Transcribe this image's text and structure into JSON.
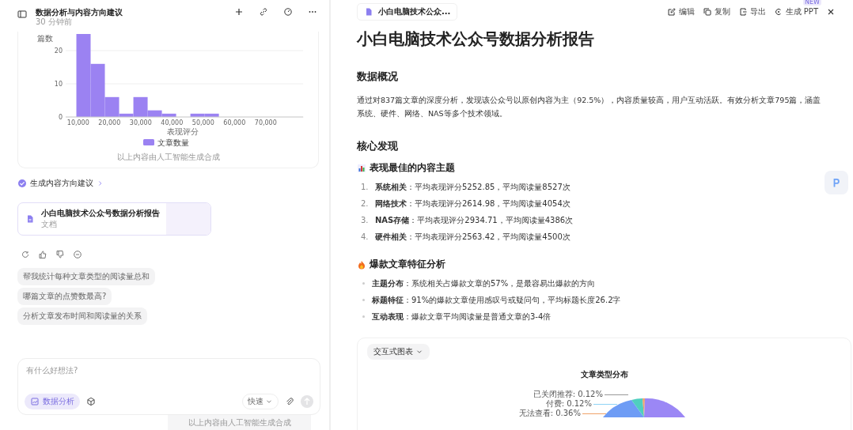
{
  "chat": {
    "title": "数据分析与内容方向建议",
    "time": "30 分钟前",
    "histogram": {
      "chart_data": {
        "type": "bar",
        "xlabel": "表现评分",
        "ylabel": "篇数",
        "x": [
          11700,
          16260,
          20820,
          25380,
          29940,
          34500,
          39060,
          43620,
          48180,
          52740
        ],
        "series": [
          {
            "name": "文章数量",
            "color": "#9b82f2",
            "values": [
              25,
              16,
              6,
              1,
              6,
              2,
              1,
              0,
              1,
              1
            ]
          }
        ],
        "xlim": [
          6000,
          82000
        ],
        "ylim": [
          0,
          25
        ],
        "xticks": [
          {
            "value": 10000,
            "label": "10,000"
          },
          {
            "value": 20000,
            "label": "20,000"
          },
          {
            "value": 30000,
            "label": "30,000"
          },
          {
            "value": 40000,
            "label": "40,000"
          },
          {
            "value": 50000,
            "label": "50,000"
          },
          {
            "value": 60000,
            "label": "60,000"
          },
          {
            "value": 70000,
            "label": "70,000"
          }
        ],
        "yticks": [
          0,
          10,
          20
        ]
      },
      "footnote": "以上内容由人工智能生成合成"
    },
    "step": {
      "label": "生成内容方向建议",
      "done": true
    },
    "doc_card": {
      "title": "小白电脑技术公众号数据分析报告",
      "type": "文档"
    },
    "suggestions": [
      "帮我统计每种文章类型的阅读量总和",
      "哪篇文章的点赞数最高?",
      "分析文章发布时间和阅读量的关系"
    ],
    "composer": {
      "placeholder": "有什么好想法?",
      "mode_chip": "数据分析",
      "speed": "快速"
    },
    "disclaimer": "以上内容由人工智能生成合成"
  },
  "document": {
    "tab": "小白电脑技术公众...",
    "actions": [
      {
        "label": "编辑",
        "kind": "edit"
      },
      {
        "label": "复制",
        "kind": "copy"
      },
      {
        "label": "导出",
        "kind": "export"
      },
      {
        "label": "生成 PPT",
        "kind": "ppt",
        "badge": "NEW"
      }
    ],
    "title": "小白电脑技术公众号数据分析报告",
    "overview": {
      "heading": "数据概况",
      "text": "通过对837篇文章的深度分析，发现该公众号以原创内容为主（92.5%），内容质量较高，用户互动活跃。有效分析文章795篇，涵盖系统、硬件、网络、NAS等多个技术领域。"
    },
    "findings": {
      "heading": "核心发现",
      "groups": [
        {
          "heading": "表现最佳的内容主题",
          "kind": "ordered",
          "items": [
            "**系统相关**：平均表现评分5252.85，平均阅读量8527次",
            "**网络技术**：平均表现评分2614.98，平均阅读量4054次",
            "**NAS存储**：平均表现评分2934.71，平均阅读量4386次",
            "**硬件相关**：平均表现评分2563.42，平均阅读量4500次"
          ],
          "numbers": [
            "1.",
            "2.",
            "3.",
            "4."
          ]
        },
        {
          "heading": "爆款文章特征分析",
          "kind": "bullet",
          "items": [
            "**主题分布**：系统相关占爆款文章的57%，是最容易出爆款的方向",
            "**标题特征**：91%的爆款文章使用感叹号或疑问句，平均标题长度26.2字",
            "**互动表现**：爆款文章平均阅读量是普通文章的3-4倍"
          ]
        }
      ]
    },
    "chart_card": {
      "dropdown": "交互式图表",
      "title": "文章类型分布",
      "labels": [
        "已关闭推荐: 0.12%",
        "付费: 0.12%",
        "无法查看: 0.36%"
      ]
    }
  }
}
